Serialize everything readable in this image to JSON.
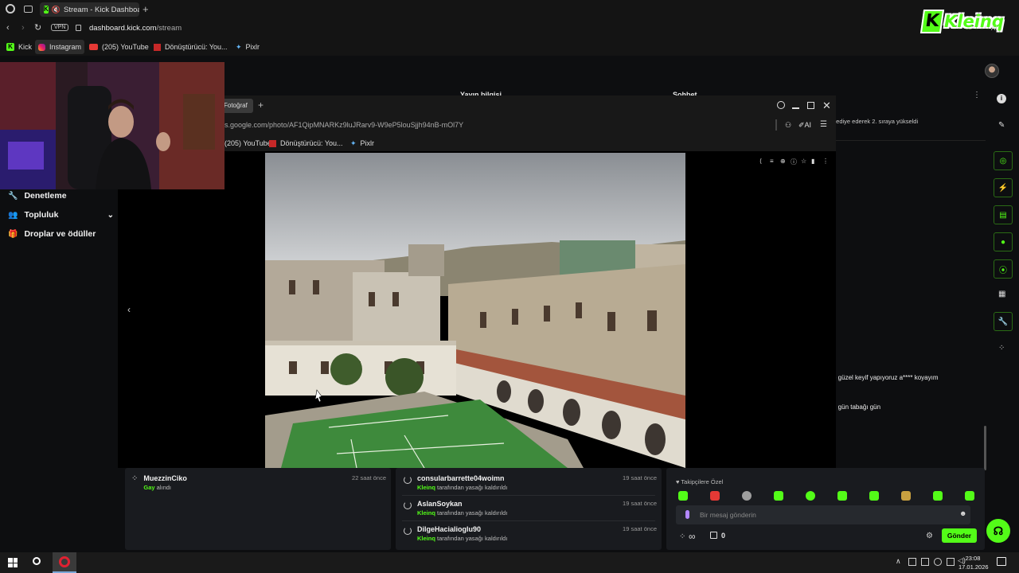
{
  "browser": {
    "tab_title": "Stream - Kick Dashboard",
    "url_domain": "dashboard.kick.com",
    "url_path": "/stream",
    "vpn_badge": "VPN",
    "bookmarks": [
      "Kick",
      "Instagram",
      "(205) YouTube",
      "Dönüştürücü: You...",
      "Pixlr"
    ]
  },
  "logo_text": "Kleinq",
  "logo_tail": "AI",
  "sidebar": {
    "items": [
      {
        "label": "Denetleme"
      },
      {
        "label": "Topluluk"
      },
      {
        "label": "Droplar ve ödüller"
      }
    ]
  },
  "panels": {
    "yayin_title": "Yayın bilgisi",
    "sohbet_title": "Sohbet"
  },
  "chat": {
    "pinned_line": "hediye ederek 2. sıraya yükseldi",
    "msg1": "e güzel keyif yapıyoruz a**** koyayım",
    "msg2": "n gün tabağı gün",
    "followers_label": "Takipçilere Özel",
    "input_placeholder": "Bir mesaj gönderin",
    "send_label": "Gönder",
    "infinity": "∞",
    "count": "0"
  },
  "viewer": {
    "tab_label": "Fotoğraf",
    "url": "s.google.com/photo/AF1QipMNARKz9luJRarv9-W9eP5louSjjh94nB-mOl7Y",
    "ai_label": "AI",
    "bookmarks": [
      "(205) YouTube",
      "Dönüştürücü: You...",
      "Pixlr"
    ]
  },
  "activity_left": [
    {
      "user": "MuezzinCiko",
      "sub_green": "Gay",
      "sub_rest": "alındı",
      "time": "22 saat önce"
    }
  ],
  "activity_right": [
    {
      "user": "consularbarrette04woimn",
      "sub_green": "Kleinq",
      "sub_rest": "tarafından yasağı kaldırıldı",
      "time": "19 saat önce"
    },
    {
      "user": "AslanSoykan",
      "sub_green": "Kleinq",
      "sub_rest": "tarafından yasağı kaldırıldı",
      "time": "19 saat önce"
    },
    {
      "user": "DilgeHacialioglu90",
      "sub_green": "Kleinq",
      "sub_rest": "tarafından yasağı kaldırıldı",
      "time": "19 saat önce"
    }
  ],
  "taskbar": {
    "time": "23:08",
    "date": "17.01.2026"
  },
  "colors": {
    "accent": "#53fc18",
    "background": "#0d0e10",
    "panel": "#191b1f"
  },
  "icons": [
    "search-icon",
    "undo-icon",
    "gear-icon",
    "send-icon",
    "close-icon",
    "minimize-icon",
    "maximize-icon",
    "windows-icon",
    "opera-icon"
  ]
}
